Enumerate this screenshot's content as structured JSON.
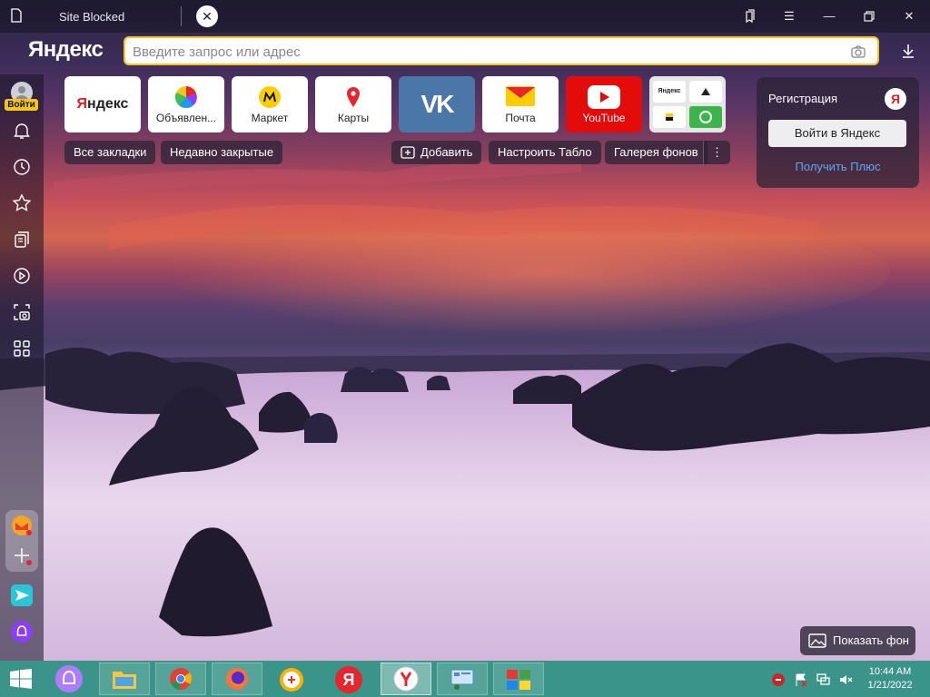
{
  "window": {
    "tab_title": "Site Blocked",
    "tab_close_icon": "close-icon",
    "controls": [
      "collections-icon",
      "menu-icon",
      "minimize-icon",
      "restore-icon",
      "close-window-icon"
    ]
  },
  "toolbar": {
    "logo": "Яндекс",
    "search_placeholder": "Введите запрос или адрес",
    "camera_icon": "camera-search-icon",
    "download_icon": "download-icon"
  },
  "sidebar": {
    "login_badge": "Войти",
    "icons": [
      "bell-icon",
      "history-icon",
      "star-icon",
      "collections-icon",
      "play-icon",
      "screenshot-icon",
      "apps-icon"
    ],
    "bottom_icons": [
      "mail-icon",
      "add-icon",
      "send-icon",
      "alice-icon"
    ]
  },
  "tiles": [
    {
      "label": "Яндекс",
      "kind": "yandex-text"
    },
    {
      "label": "Объявлен...",
      "kind": "pinwheel"
    },
    {
      "label": "Маркет",
      "kind": "market"
    },
    {
      "label": "Карты",
      "kind": "maps"
    },
    {
      "label": "VK",
      "kind": "vk"
    },
    {
      "label": "Почта",
      "kind": "mail"
    },
    {
      "label": "YouTube",
      "kind": "youtube"
    },
    {
      "label": "",
      "kind": "group",
      "mini_label": "Яндекс"
    }
  ],
  "pills": {
    "bookmarks": "Все закладки",
    "recent": "Недавно закрытые",
    "add": "Добавить",
    "configure": "Настроить Табло",
    "gallery": "Галерея фонов",
    "more": "⋮"
  },
  "panel": {
    "title": "Регистрация",
    "logo": "Я",
    "login_button": "Войти в Яндекс",
    "plus_link": "Получить Плюс"
  },
  "show_background": "Показать фон",
  "taskbar": {
    "apps": [
      "start-icon",
      "alice-icon",
      "file-explorer-icon",
      "chrome-icon",
      "firefox-icon",
      "browser-icon",
      "yandex-icon",
      "yandex-browser-icon",
      "control-panel-icon",
      "winrar-icon"
    ],
    "yandex_letter": "Я",
    "time": "10:44 AM",
    "date": "1/21/2022"
  },
  "colors": {
    "accent_yellow": "#f5c518",
    "taskbar": "#3a9489",
    "link_blue": "#5aa8ff",
    "youtube_red": "#e40b0b",
    "vk_blue": "#4a76a8"
  }
}
